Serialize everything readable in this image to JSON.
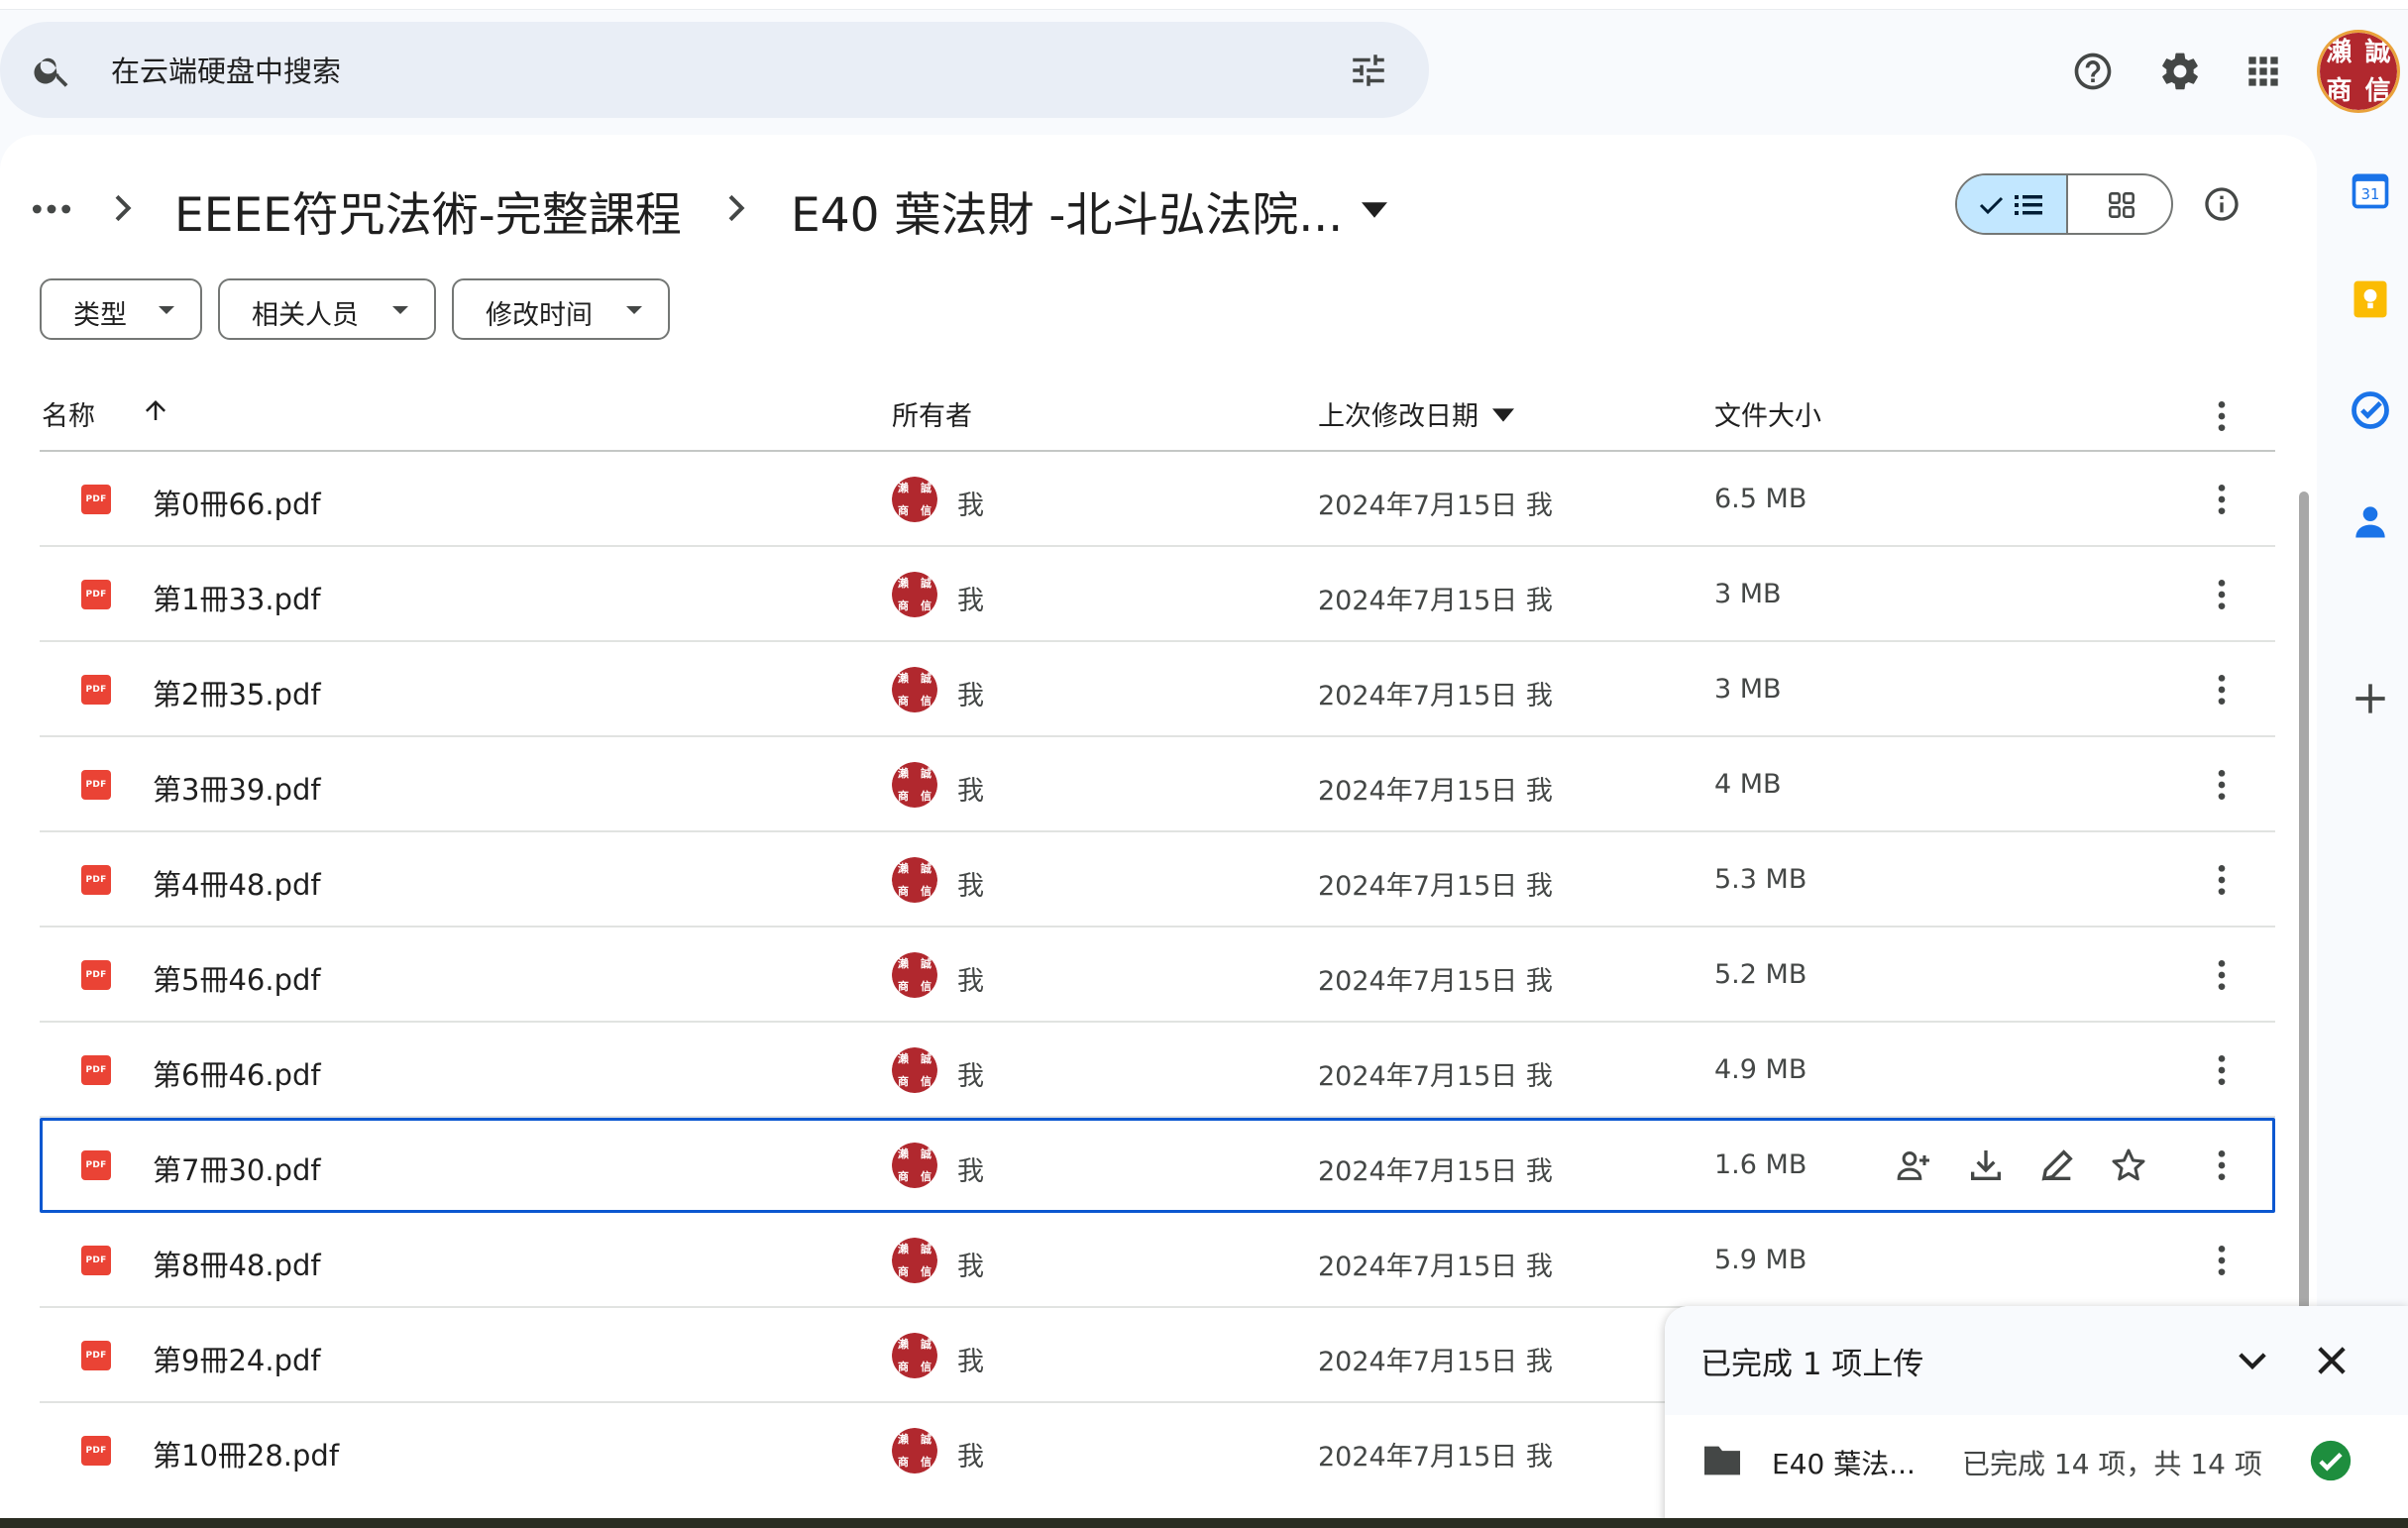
{
  "search": {
    "placeholder": "在云端硬盘中搜索"
  },
  "breadcrumb": {
    "items": [
      "EEEE符咒法術-完整課程",
      "E40 葉法財 -北斗弘法院..."
    ]
  },
  "filters": [
    "类型",
    "相关人员",
    "修改时间"
  ],
  "table": {
    "headers": {
      "name": "名称",
      "owner": "所有者",
      "modified": "上次修改日期",
      "size": "文件大小"
    },
    "rows": [
      {
        "name": "第0冊66.pdf",
        "owner": "我",
        "modified": "2024年7月15日 我",
        "size": "6.5 MB"
      },
      {
        "name": "第1冊33.pdf",
        "owner": "我",
        "modified": "2024年7月15日 我",
        "size": "3 MB"
      },
      {
        "name": "第2冊35.pdf",
        "owner": "我",
        "modified": "2024年7月15日 我",
        "size": "3 MB"
      },
      {
        "name": "第3冊39.pdf",
        "owner": "我",
        "modified": "2024年7月15日 我",
        "size": "4 MB"
      },
      {
        "name": "第4冊48.pdf",
        "owner": "我",
        "modified": "2024年7月15日 我",
        "size": "5.3 MB"
      },
      {
        "name": "第5冊46.pdf",
        "owner": "我",
        "modified": "2024年7月15日 我",
        "size": "5.2 MB"
      },
      {
        "name": "第6冊46.pdf",
        "owner": "我",
        "modified": "2024年7月15日 我",
        "size": "4.9 MB"
      },
      {
        "name": "第7冊30.pdf",
        "owner": "我",
        "modified": "2024年7月15日 我",
        "size": "1.6 MB"
      },
      {
        "name": "第8冊48.pdf",
        "owner": "我",
        "modified": "2024年7月15日 我",
        "size": "5.9 MB"
      },
      {
        "name": "第9冊24.pdf",
        "owner": "我",
        "modified": "2024年7月15日 我",
        "size": ""
      },
      {
        "name": "第10冊28.pdf",
        "owner": "我",
        "modified": "2024年7月15日 我",
        "size": ""
      }
    ]
  },
  "file_badge": "PDF",
  "avatar_seal": [
    "瀨",
    "誠",
    "商",
    "信"
  ],
  "calendar_day": "31",
  "upload": {
    "title": "已完成 1 项上传",
    "item_name": "E40 葉法...",
    "item_status": "已完成 14 项，共 14 项"
  },
  "colors": {
    "accent": "#0b57d0",
    "selected_toggle": "#c2e7ff",
    "pdf": "#ea4335",
    "success": "#1e8e3e"
  }
}
